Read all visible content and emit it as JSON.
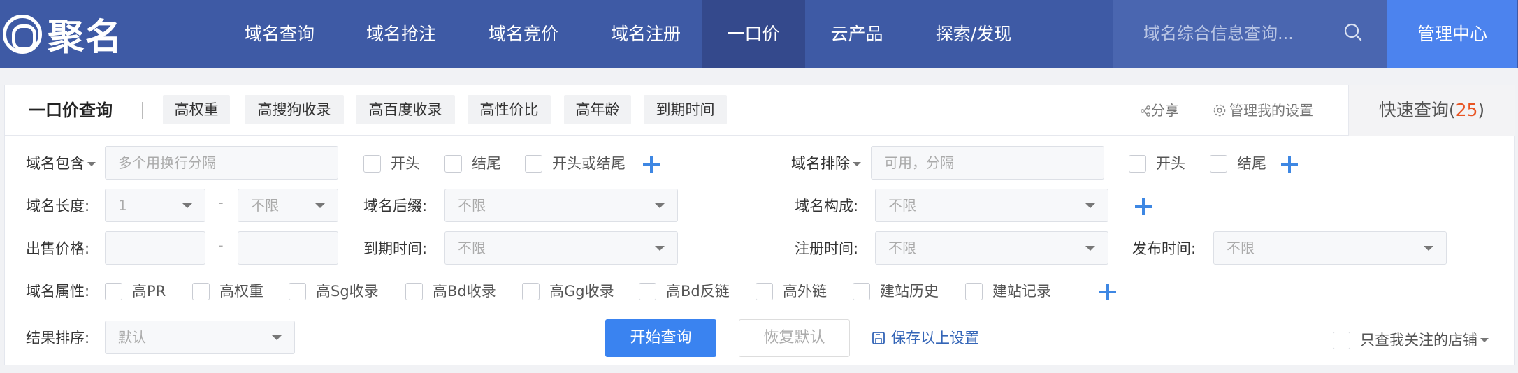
{
  "nav": {
    "logo_text": "聚名",
    "items": [
      "域名查询",
      "域名抢注",
      "域名竞价",
      "域名注册",
      "一口价",
      "云产品",
      "探索/发现"
    ],
    "search_placeholder": "域名综合信息查询...",
    "manage_label": "管理中心",
    "active_item": "一口价"
  },
  "toolbar": {
    "title": "一口价查询",
    "tags": [
      "高权重",
      "高搜狗收录",
      "高百度收录",
      "高性价比",
      "高年龄",
      "到期时间"
    ],
    "share_label": "分享",
    "settings_label": "管理我的设置",
    "quick_label": "快速查询(",
    "quick_count": "25",
    "quick_close": ")"
  },
  "filters": {
    "contains": {
      "label": "域名包含",
      "placeholder": "多个用换行分隔",
      "options": [
        "开头",
        "结尾",
        "开头或结尾"
      ]
    },
    "excludes": {
      "label": "域名排除",
      "placeholder": "可用，分隔",
      "options": [
        "开头",
        "结尾"
      ]
    },
    "length": {
      "label": "域名长度:",
      "min": "1",
      "dash": "-",
      "max": "不限"
    },
    "suffix": {
      "label": "域名后缀:",
      "value": "不限"
    },
    "composition": {
      "label": "域名构成:",
      "value": "不限"
    },
    "price": {
      "label": "出售价格:",
      "dash": "-"
    },
    "expire": {
      "label": "到期时间:",
      "value": "不限"
    },
    "register": {
      "label": "注册时间:",
      "value": "不限"
    },
    "publish": {
      "label": "发布时间:",
      "value": "不限"
    },
    "attributes": {
      "label": "域名属性:",
      "options": [
        "高PR",
        "高权重",
        "高Sg收录",
        "高Bd收录",
        "高Gg收录",
        "高Bd反链",
        "高外链",
        "建站历史",
        "建站记录"
      ]
    },
    "sort": {
      "label": "结果排序:",
      "value": "默认"
    }
  },
  "actions": {
    "search": "开始查询",
    "reset": "恢复默认",
    "save": "保存以上设置",
    "only_followed": "只查我关注的店铺"
  },
  "colors": {
    "nav_bg": "#3e5aa5",
    "accent": "#3a83f0",
    "count": "#e85423"
  }
}
